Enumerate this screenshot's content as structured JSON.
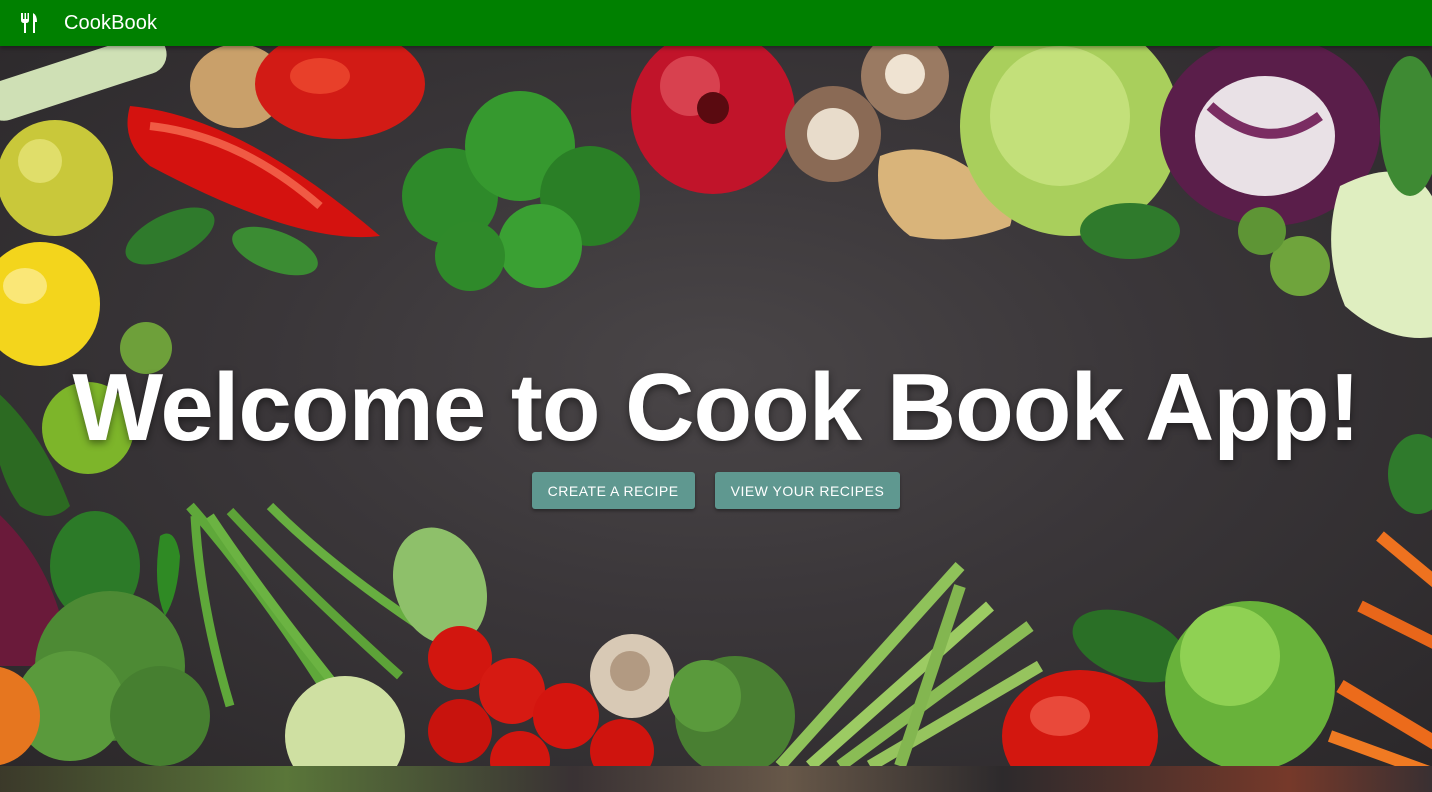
{
  "appbar": {
    "icon": "restaurant-icon",
    "brand": "CookBook",
    "color": "#008000"
  },
  "hero": {
    "title": "Welcome to Cook Book App!",
    "background": "vegetables-on-dark-table-photo"
  },
  "actions": {
    "create_label": "CREATE A RECIPE",
    "view_label": "VIEW YOUR RECIPES",
    "button_color": "#5f9890"
  }
}
